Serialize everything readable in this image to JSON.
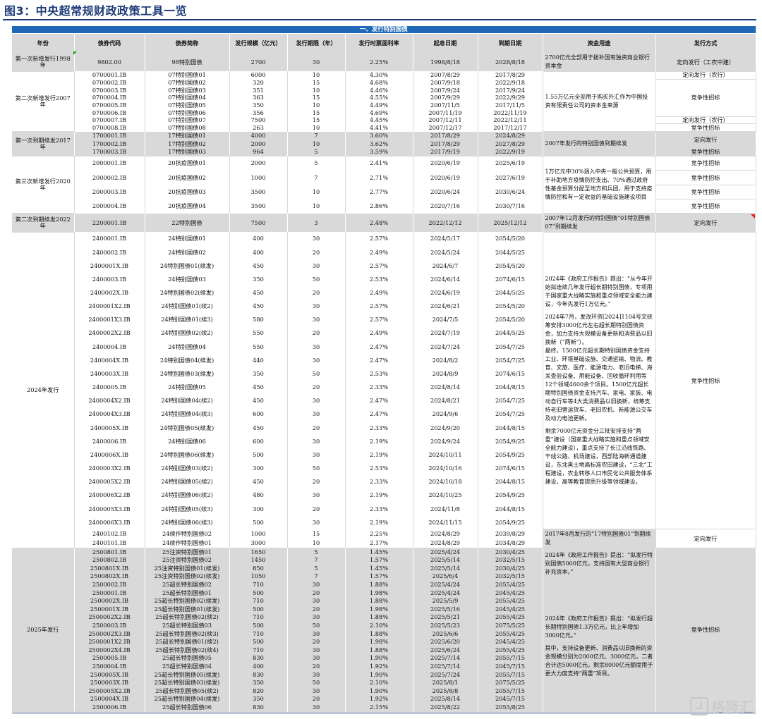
{
  "page": {
    "title": "图3：中央超常规财政政策工具一览",
    "section_banner": "一、发行特别国债",
    "watermark": "格隆汇"
  },
  "columns": [
    "年份",
    "债券代码",
    "债券简称",
    "发行规模（亿元）",
    "发行期限（年）",
    "发行时票面利率",
    "起息日期",
    "到期日期",
    "资金用途",
    "发行方式"
  ],
  "groups": [
    {
      "year": "第一次新增发行1998年",
      "bg": "gray",
      "rows": [
        [
          "9802.00",
          "98特别国债",
          "2700",
          "30",
          "2.25%",
          "1998/8/18",
          "2028/8/18"
        ]
      ],
      "uses": [
        {
          "span": 1,
          "text": "2700亿元全部用于拨补国有独资商业银行资本金"
        }
      ],
      "methods": [
        {
          "span": 1,
          "text": "定向发行（工农中建）"
        }
      ]
    },
    {
      "year": "第二次新增发行2007年",
      "bg": "white",
      "rows": [
        [
          "0700001.IB",
          "07特别国债01",
          "6000",
          "10",
          "4.30%",
          "2007/8/29",
          "2017/8/29"
        ],
        [
          "0700002.IB",
          "07特别国债02",
          "320",
          "15",
          "4.68%",
          "2007/9/18",
          "2022/9/18"
        ],
        [
          "0700003.IB",
          "07特别国债03",
          "351",
          "10",
          "4.46%",
          "2007/9/24",
          "2017/9/24"
        ],
        [
          "0700004.IB",
          "07特别国债04",
          "363",
          "15",
          "4.55%",
          "2007/9/29",
          "2022/9/29"
        ],
        [
          "0700005.IB",
          "07特别国债05",
          "350",
          "10",
          "4.49%",
          "2007/11/5",
          "2017/11/5"
        ],
        [
          "0700006.IB",
          "07特别国债06",
          "356",
          "15",
          "4.69%",
          "2007/11/19",
          "2022/11/19"
        ],
        [
          "0700007.IB",
          "07特别国债07",
          "7500",
          "15",
          "4.45%",
          "2007/12/11",
          "2022/12/11"
        ],
        [
          "0700008.IB",
          "07特别国债08",
          "263",
          "10",
          "4.41%",
          "2007/12/17",
          "2017/12/17"
        ]
      ],
      "uses": [
        {
          "span": 8,
          "text": "1.55万亿元全部用于购买外汇作为中国投资有限责任公司的资本金来源"
        }
      ],
      "methods": [
        {
          "span": 1,
          "text": "定向发行（农行）"
        },
        {
          "span": 5,
          "text": "竞争性招标"
        },
        {
          "span": 1,
          "text": "定向发行（农行）"
        },
        {
          "span": 1,
          "text": "竞争性招标"
        }
      ]
    },
    {
      "year": "第一次到期续发2017年",
      "bg": "gray",
      "rows": [
        [
          "1700001.IB",
          "17特别国债01",
          "4000",
          "7",
          "3.60%",
          "2017/8/29",
          "2024/8/29"
        ],
        [
          "1700002.IB",
          "17特别国债02",
          "2000",
          "10",
          "3.62%",
          "2017/8/29",
          "2027/8/29"
        ],
        [
          "1700003.IB",
          "17特别国债03",
          "964",
          "5",
          "3.59%",
          "2017/9/19",
          "2022/9/19"
        ]
      ],
      "uses": [
        {
          "span": 3,
          "text": "2007年发行的特别国债到期续发"
        }
      ],
      "methods": [
        {
          "span": 2,
          "text": "定向发行"
        },
        {
          "span": 1,
          "text": "竞争性招标"
        }
      ]
    },
    {
      "year": "第三次新增发行2020年",
      "bg": "white",
      "rows": [
        [
          "2000001.IB",
          "20抗疫国债01",
          "2000",
          "5",
          "2.41%",
          "2020/6/19",
          "2025/6/19"
        ],
        [
          "2000002.IB",
          "20抗疫国债02",
          "1000",
          "7",
          "2.71%",
          "2020/6/19",
          "2027/6/19"
        ],
        [
          "2000003.IB",
          "20抗疫国债03",
          "3500",
          "10",
          "2.77%",
          "2020/6/24",
          "2030/6/24"
        ],
        [
          "2000004.IB",
          "20抗疫国债04",
          "3500",
          "10",
          "2.86%",
          "2020/7/16",
          "2030/7/16"
        ]
      ],
      "uses": [
        {
          "span": 4,
          "text": "1万亿元中30%调入中央一般公共预算，用于补助地方疫情防控支出、70%通过政府性基金预算分配至地方和兵团，用于支持疫情防控和有一定收益的基础设施建设项目"
        }
      ],
      "methods": [
        {
          "span": 1,
          "text": "竞争性招标"
        },
        {
          "span": 1,
          "text": "竞争性招标"
        },
        {
          "span": 1,
          "text": "竞争性招标"
        },
        {
          "span": 1,
          "text": "竞争性招标"
        }
      ]
    },
    {
      "year": "第二次到期续发2022年",
      "bg": "gray",
      "rows": [
        [
          "2200001.IB",
          "22特别国债",
          "7500",
          "3",
          "2.48%",
          "2022/12/12",
          "2025/12/12"
        ]
      ],
      "uses": [
        {
          "span": 1,
          "text": "2007年12月发行的特别国债“01特别国债07”到期续发"
        }
      ],
      "methods": [
        {
          "span": 1,
          "text": "定向发行"
        }
      ]
    },
    {
      "year": "2024年发行",
      "bg": "white",
      "rows": [
        [
          "2400001.IB",
          "24特别国债01",
          "400",
          "30",
          "2.57%",
          "2024/5/17",
          "2054/5/20"
        ],
        [
          "2400002.IB",
          "24特别国债02",
          "400",
          "20",
          "2.49%",
          "2024/5/24",
          "2044/5/25"
        ],
        [
          "2400001X.IB",
          "24特别国债01(续发)",
          "450",
          "30",
          "2.57%",
          "2024/6/7",
          "2054/5/20"
        ],
        [
          "2400003.IB",
          "24特别国债03",
          "350",
          "50",
          "2.53%",
          "2024/6/14",
          "2074/6/15"
        ],
        [
          "2400002X.IB",
          "24特别国债02(续发)",
          "450",
          "20",
          "2.49%",
          "2024/6/19",
          "2044/5/25"
        ],
        [
          "2400001X2.IB",
          "24特别国债01(续2)",
          "450",
          "30",
          "2.57%",
          "2024/6/21",
          "2054/5/20"
        ],
        [
          "2400001X3.IB",
          "24特别国债01(续3)",
          "580",
          "30",
          "2.57%",
          "2024/7/5",
          "2054/5/20"
        ],
        [
          "2400002X2.IB",
          "24特别国债02(续2)",
          "550",
          "20",
          "2.49%",
          "2024/7/19",
          "2044/5/25"
        ],
        [
          "2400004.IB",
          "24特别国债04",
          "550",
          "30",
          "2.47%",
          "2024/7/24",
          "2054/7/25"
        ],
        [
          "2400004X.IB",
          "24特别国债04(续发)",
          "440",
          "30",
          "2.47%",
          "2024/8/2",
          "2054/7/25"
        ],
        [
          "2400003X.IB",
          "24特别国债03(续发)",
          "350",
          "50",
          "2.53%",
          "2024/8/9",
          "2074/6/15"
        ],
        [
          "2400005.IB",
          "24特别国债05",
          "450",
          "20",
          "2.33%",
          "2024/8/14",
          "2044/8/15"
        ],
        [
          "2400004X2.IB",
          "24特别国债04(续2)",
          "450",
          "30",
          "2.47%",
          "2024/8/21",
          "2054/7/25"
        ],
        [
          "2400004X3.IB",
          "24特别国债04(续3)",
          "600",
          "30",
          "2.47%",
          "2024/9/6",
          "2054/7/25"
        ],
        [
          "2400005X.IB",
          "24特别国债05(续发)",
          "450",
          "20",
          "2.33%",
          "2024/9/20",
          "2044/8/15"
        ],
        [
          "2400006.IB",
          "24特别国债06",
          "600",
          "30",
          "2.19%",
          "2024/9/24",
          "2054/9/25"
        ],
        [
          "2400006X.IB",
          "24特别国债06(续发)",
          "500",
          "30",
          "2.19%",
          "2024/10/11",
          "2054/9/25"
        ],
        [
          "2400003X2.IB",
          "24特别国债03(续2)",
          "300",
          "50",
          "2.53%",
          "2024/10/16",
          "2074/6/15"
        ],
        [
          "2400005X2.IB",
          "24特别国债05(续2)",
          "450",
          "20",
          "2.33%",
          "2024/10/18",
          "2044/8/15"
        ],
        [
          "2400006X2.IB",
          "24特别国债06(续2)",
          "480",
          "30",
          "2.19%",
          "2024/10/25",
          "2054/9/25"
        ],
        [
          "2400005X3.IB",
          "24特别国债05(续3)",
          "300",
          "20",
          "2.33%",
          "2024/11/8",
          "2044/8/15"
        ],
        [
          "2400006X3.IB",
          "24特别国债06(续3)",
          "500",
          "30",
          "2.19%",
          "2024/11/15",
          "2054/9/25"
        ],
        [
          "2400102.IB",
          "24续作特别国债02",
          "1000",
          "15",
          "2.25%",
          "2024/8/29",
          "2039/8/29"
        ],
        [
          "2400101.IB",
          "24续作特别国债01",
          "3000",
          "10",
          "2.17%",
          "2024/8/29",
          "2034/8/29"
        ]
      ],
      "uses": [
        {
          "span": 22,
          "text": "2024年《政府工作报告》提出：“从今年开始拟连续几年发行超长期特别国债，专项用于国家重大战略实施和重点领域安全能力建设，今年先发行1万亿元。”\n\n2024年7月，发改环资[2024]1104号文统筹安排3000亿元左右超长期特别国债资金，加力支持大规模设备更新和消费品以旧换新（“两新”）。\n最终，1500亿元超长期特别国债资金支持工业、环境基础设施、交通运输、物流、教育、文旅、医疗、能源电力、老旧电梯、海关查验设备、用能设备、回收循环利用等12个领域4600余个项目。1500亿元超长期特别国债资金支持汽车、家电、家装、电动自行车等4大类消费品以旧换新，统筹支持老旧营运货车、老旧农机、新能源公交车及动力电池更新。\n\n剩余7000亿元资金分三批安排支持“两重”建设（国家重大战略实施和重点领域安全能力建设），重点支持了长江沿线铁路、干线公路、机场建设，西部陆海新通道建设，东北黑土地高标准农田建设，“三北”工程建设，农业转移人口市民化公共服务体系建设，高等教育提质升级等领域建设。"
        },
        {
          "span": 2,
          "text": "2017年8月发行的“17特别国债01”到期续发"
        }
      ],
      "methods": [
        {
          "span": 22,
          "text": "竞争性招标"
        },
        {
          "span": 2,
          "text": "定向发行"
        }
      ]
    },
    {
      "year": "2025年发行",
      "bg": "gray",
      "rows": [
        [
          "2500801.IB",
          "25注资特别国债01",
          "1650",
          "5",
          "1.45%",
          "2025/4/24",
          "2030/4/25"
        ],
        [
          "2500802.IB",
          "25注资特别国债02",
          "1450",
          "7",
          "1.57%",
          "2025/5/14",
          "2032/5/15"
        ],
        [
          "2500801X.IB",
          "25注资特别国债01(续发)",
          "850",
          "5",
          "1.45%",
          "2025/5/14",
          "2030/4/25"
        ],
        [
          "2500802X.IB",
          "25注资特别国债02(续发)",
          "1050",
          "7",
          "1.57%",
          "2025/6/4",
          "2032/5/15"
        ],
        [
          "2500002.IB",
          "25超长特别国债02",
          "710",
          "30",
          "1.88%",
          "2025/4/24",
          "2055/4/25"
        ],
        [
          "2500001.IB",
          "25超长特别国债01",
          "500",
          "20",
          "1.98%",
          "2025/4/24",
          "2045/4/25"
        ],
        [
          "2500002X.IB",
          "25超长特别国债02(续发)",
          "710",
          "30",
          "1.88%",
          "2025/5/9",
          "2055/4/25"
        ],
        [
          "2500001X.IB",
          "25超长特别国债01(续发)",
          "500",
          "20",
          "1.98%",
          "2025/5/16",
          "2045/4/25"
        ],
        [
          "2500002X2.IB",
          "25超长特别国债02(续2)",
          "710",
          "30",
          "1.88%",
          "2025/5/21",
          "2055/4/25"
        ],
        [
          "2500003.IB",
          "25超长特别国债03",
          "500",
          "50",
          "2.10%",
          "2025/5/23",
          "2075/5/25"
        ],
        [
          "2500002X3.IB",
          "25超长特别国债02(续3)",
          "710",
          "30",
          "1.88%",
          "2025/6/6",
          "2055/4/25"
        ],
        [
          "2500001X2.IB",
          "25超长特别国债01(续2)",
          "500",
          "20",
          "1.98%",
          "2025/6/20",
          "2045/4/25"
        ],
        [
          "2500002X4.IB",
          "25超长特别国债02(续4)",
          "710",
          "30",
          "1.88%",
          "2025/6/24",
          "2055/4/25"
        ],
        [
          "2500005.IB",
          "25超长特别国债05",
          "830",
          "30",
          "1.90%",
          "2025/7/14",
          "2055/7/15"
        ],
        [
          "2500004.IB",
          "25超长特别国债04",
          "400",
          "20",
          "1.92%",
          "2025/7/14",
          "2045/7/15"
        ],
        [
          "2500005X.IB",
          "25超长特别国债05(续发)",
          "830",
          "30",
          "1.90%",
          "2025/7/24",
          "2055/7/15"
        ],
        [
          "2500003X.IB",
          "25超长特别国债03(续发)",
          "350",
          "50",
          "2.10%",
          "2025/8/1",
          "2075/5/25"
        ],
        [
          "2500005X2.IB",
          "25超长特别国债05(续2)",
          "820",
          "30",
          "1.90%",
          "2025/8/8",
          "2055/7/15"
        ],
        [
          "2500004X.IB",
          "25超长特别国债04(续发)",
          "350",
          "20",
          "1.92%",
          "2025/8/14",
          "2045/7/15"
        ],
        [
          "2500006.IB",
          "25超长特别国债06",
          "830",
          "30",
          "2.15%",
          "2025/8/22",
          "2055/8/25"
        ]
      ],
      "uses": [
        {
          "span": 4,
          "text": "2024年《政府工作报告》提出：“拟发行特别国债5000亿元，支持国有大型商业银行补充资本。”"
        },
        {
          "span": 16,
          "text": "2024年《政府工作报告》提出：“拟发行超长期特别国债1.3万亿元，比上年增加3000亿元。”\n\n其中，支持设备更新、消费品以旧换新的资金规模分别为2000亿元、3000亿元，二者合计达5000亿元。剩余8000亿元额度用于更大力度支持“两重”项目。"
        }
      ],
      "methods": [
        {
          "span": 20,
          "text": "竞争性招标"
        }
      ]
    }
  ]
}
